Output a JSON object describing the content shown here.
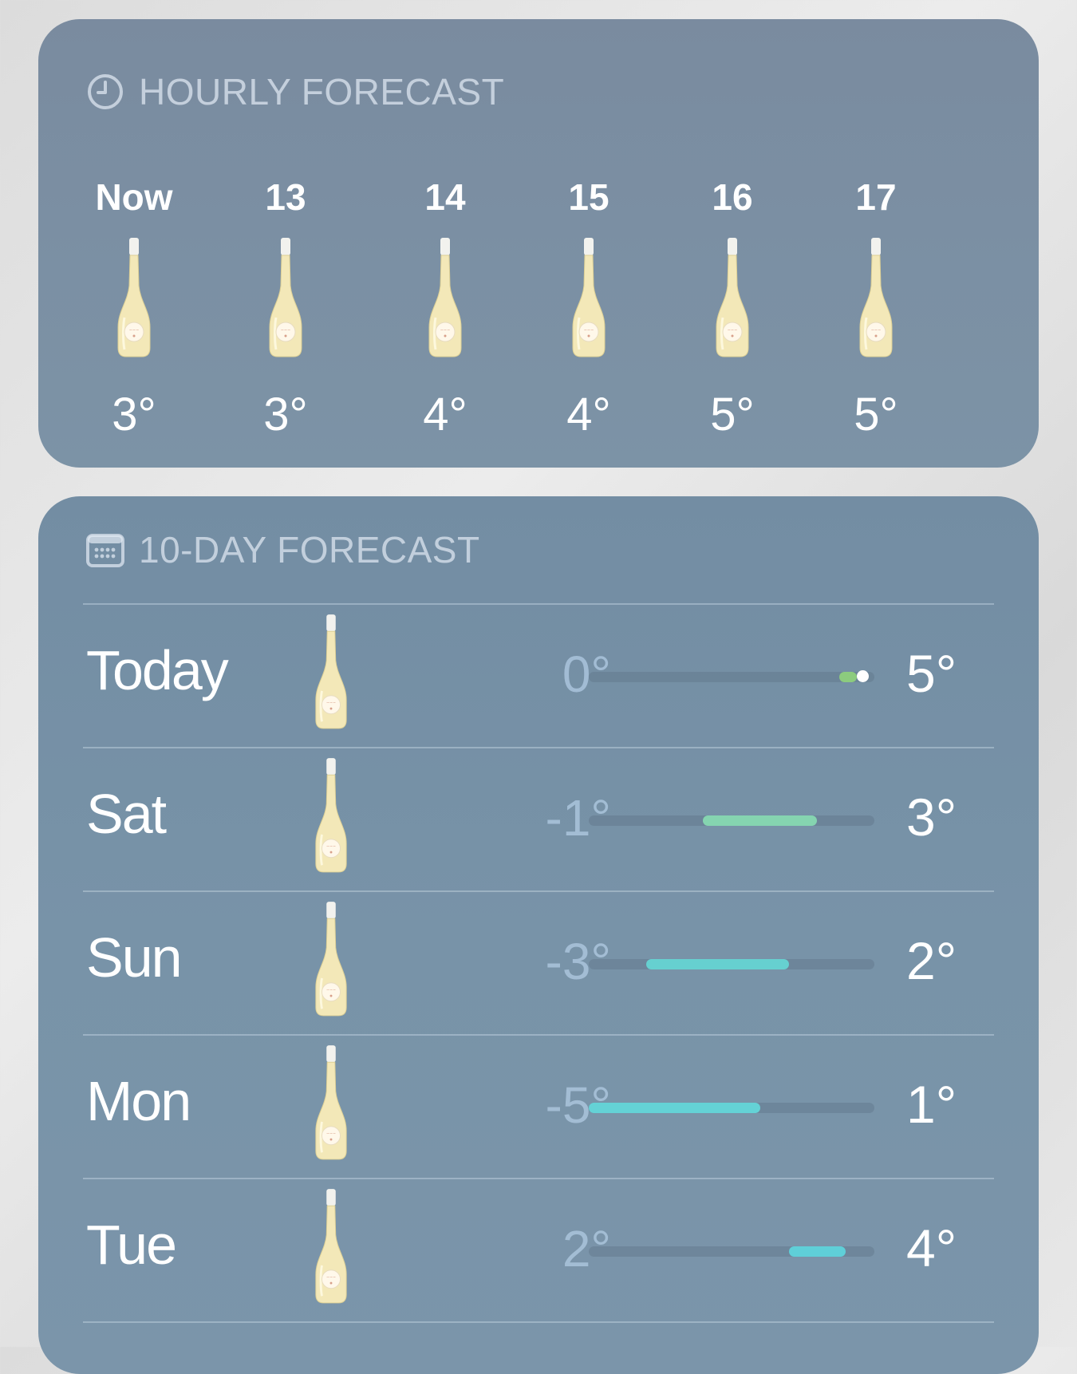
{
  "hourly": {
    "header": "HOURLY FORECAST",
    "header_icon": "clock-icon",
    "items": [
      {
        "time": "Now",
        "temp": "3°",
        "icon": "wine-bottle-icon"
      },
      {
        "time": "13",
        "temp": "3°",
        "icon": "wine-bottle-icon"
      },
      {
        "time": "14",
        "temp": "4°",
        "icon": "wine-bottle-icon"
      },
      {
        "time": "15",
        "temp": "4°",
        "icon": "wine-bottle-icon"
      },
      {
        "time": "16",
        "temp": "5°",
        "icon": "wine-bottle-icon"
      },
      {
        "time": "17",
        "temp": "5°",
        "icon": "wine-bottle-icon"
      }
    ]
  },
  "daily": {
    "header": "10-DAY FORECAST",
    "header_icon": "calendar-icon",
    "range_min": -5,
    "range_max": 5,
    "current_temp": 3,
    "days": [
      {
        "day": "Today",
        "low": "0°",
        "high": "5°",
        "low_value": 0,
        "high_value": 5,
        "bar_color": "#8ccb7e",
        "icon": "wine-bottle-icon"
      },
      {
        "day": "Sat",
        "low": "-1°",
        "high": "3°",
        "low_value": -1,
        "high_value": 3,
        "bar_color": "#85d4b0",
        "icon": "wine-bottle-icon"
      },
      {
        "day": "Sun",
        "low": "-3°",
        "high": "2°",
        "low_value": -3,
        "high_value": 2,
        "bar_color": "#66d0d0",
        "icon": "wine-bottle-icon"
      },
      {
        "day": "Mon",
        "low": "-5°",
        "high": "1°",
        "low_value": -5,
        "high_value": 1,
        "bar_color": "#64d2d6",
        "icon": "wine-bottle-icon"
      },
      {
        "day": "Tue",
        "low": "2°",
        "high": "4°",
        "low_value": 2,
        "high_value": 4,
        "bar_color": "#5fcfd8",
        "icon": "wine-bottle-icon"
      }
    ]
  },
  "colors": {
    "card_background": "#7a8fa4",
    "primary_text": "#ffffff",
    "low_temp_text": "#aac4dc"
  }
}
